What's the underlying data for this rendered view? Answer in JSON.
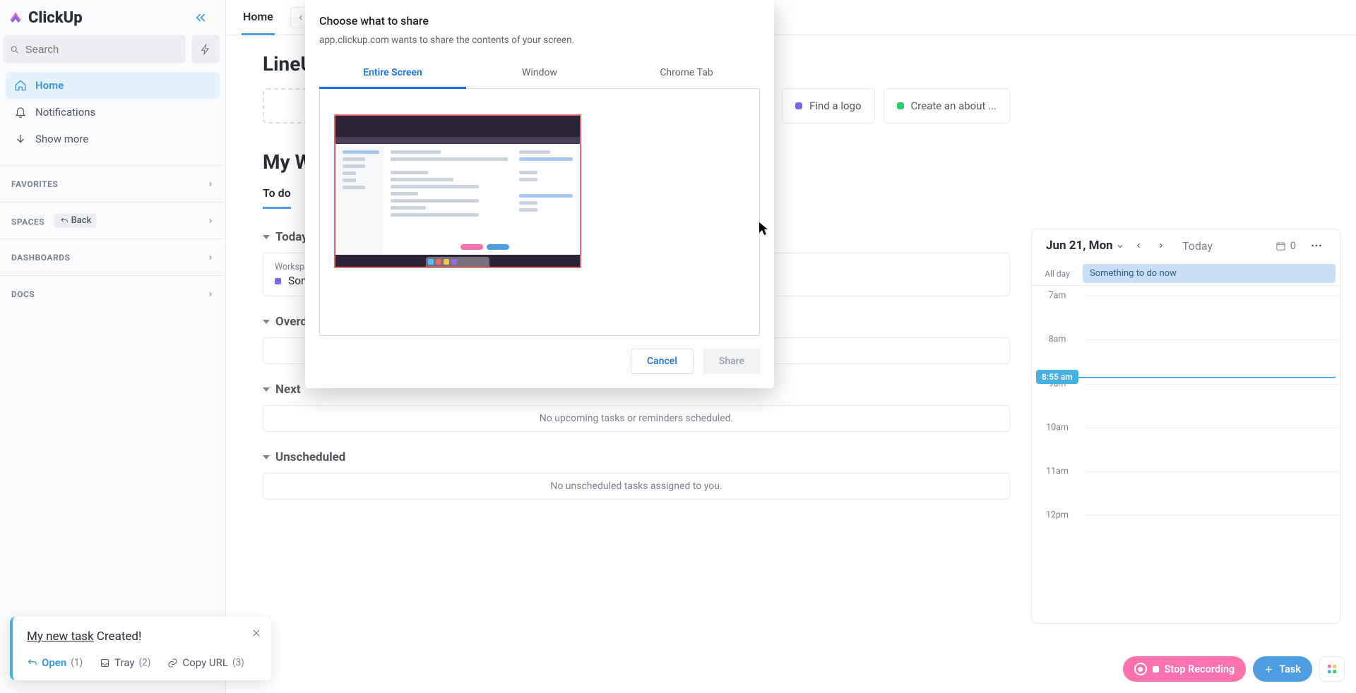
{
  "brand": {
    "name": "ClickUp",
    "accent": "#4f9ee3"
  },
  "sidebar": {
    "search_placeholder": "Search",
    "nav": [
      {
        "label": "Home",
        "active": true,
        "icon": "home-icon"
      },
      {
        "label": "Notifications",
        "active": false,
        "icon": "bell-icon"
      },
      {
        "label": "Show more",
        "active": false,
        "icon": "chevron-down-icon"
      }
    ],
    "sections": [
      {
        "label": "FAVORITES"
      },
      {
        "label": "SPACES",
        "back_label": "Back"
      },
      {
        "label": "DASHBOARDS"
      },
      {
        "label": "DOCS"
      }
    ]
  },
  "topbar": {
    "tab": "Home"
  },
  "lineups": {
    "title": "LineUp",
    "chips": [
      {
        "label": "Find a logo",
        "color": "#7b68ee"
      },
      {
        "label": "Create an about ...",
        "color": "#2ecc71"
      }
    ]
  },
  "mywork": {
    "title": "My Work",
    "subtabs": [
      {
        "label": "To do",
        "active": true
      }
    ],
    "groups": [
      {
        "label": "Today",
        "tasks": [
          {
            "crumb": "Workspace / Onboarding",
            "title": "Something to do now",
            "color": "#7b68ee"
          }
        ]
      },
      {
        "label": "Overdue",
        "empty": " "
      },
      {
        "label": "Next",
        "empty": "No upcoming tasks or reminders scheduled."
      },
      {
        "label": "Unscheduled",
        "empty": "No unscheduled tasks assigned to you."
      }
    ]
  },
  "calendar": {
    "date_label": "Jun 21, Mon",
    "today_label": "Today",
    "unscheduled_count": "0",
    "all_day_label": "All day",
    "all_day_event": "Something to do now",
    "now_label": "8:55 am",
    "hours": [
      {
        "label": "7am",
        "pct": 3
      },
      {
        "label": "8am",
        "pct": 16
      },
      {
        "label": "9am",
        "pct": 29
      },
      {
        "label": "10am",
        "pct": 42
      },
      {
        "label": "11am",
        "pct": 55
      },
      {
        "label": "12pm",
        "pct": 68
      }
    ],
    "now_pct": 27
  },
  "toast": {
    "task_name": "My new task",
    "created": "Created!",
    "open": "Open",
    "open_n": "(1)",
    "tray": "Tray",
    "tray_n": "(2)",
    "copy": "Copy URL",
    "copy_n": "(3)"
  },
  "controls": {
    "stop_recording": "Stop Recording",
    "task": "Task"
  },
  "modal": {
    "title": "Choose what to share",
    "subtitle": "app.clickup.com wants to share the contents of your screen.",
    "tabs": [
      {
        "label": "Entire Screen",
        "active": true
      },
      {
        "label": "Window",
        "active": false
      },
      {
        "label": "Chrome Tab",
        "active": false
      }
    ],
    "cancel": "Cancel",
    "share": "Share"
  }
}
